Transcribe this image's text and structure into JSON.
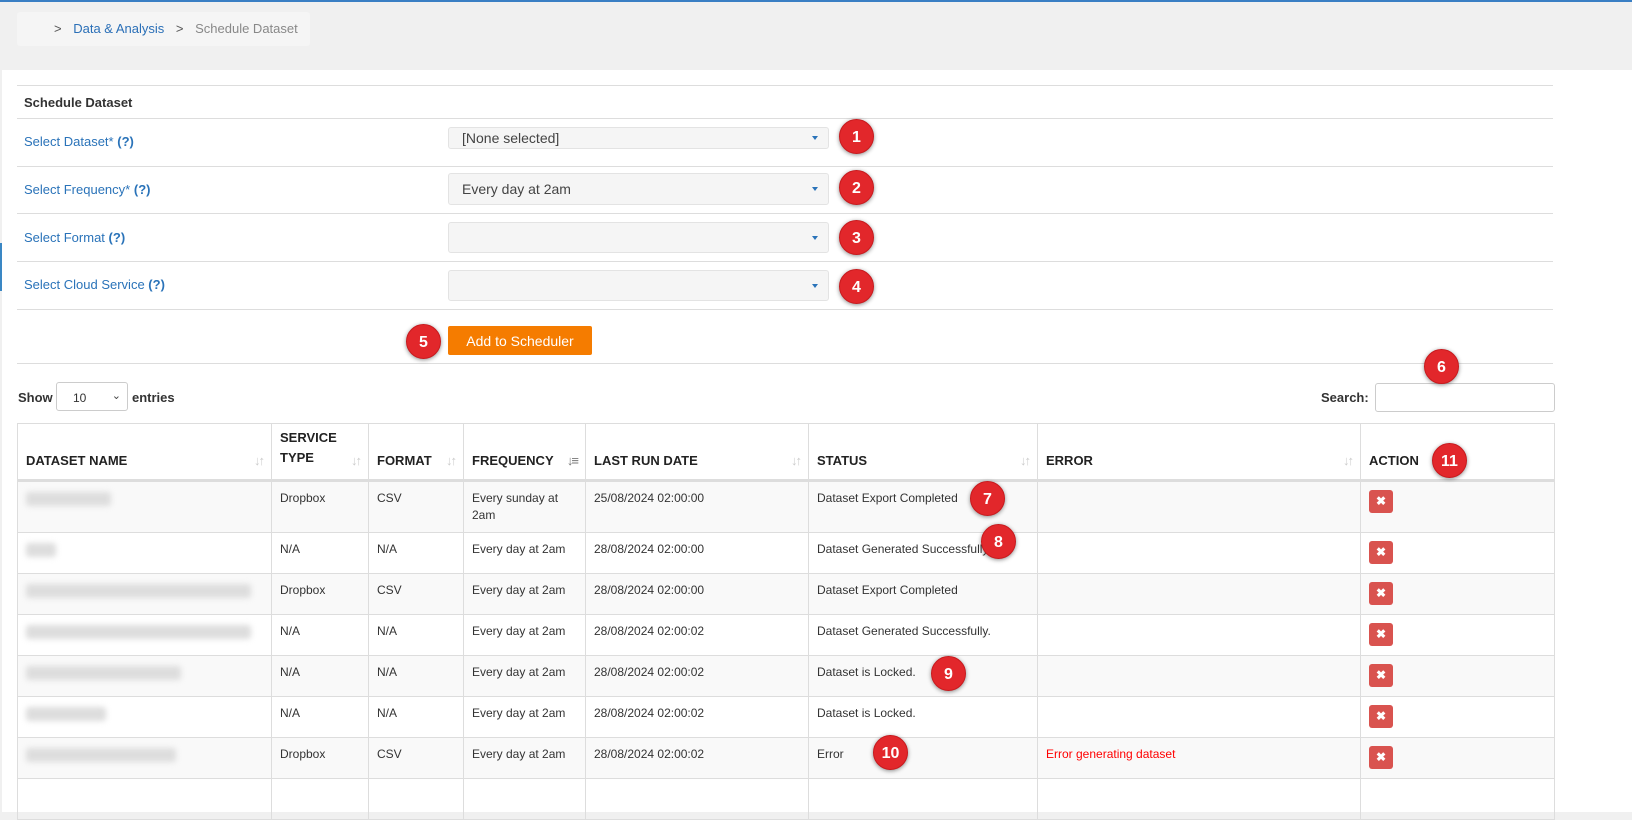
{
  "breadcrumb": {
    "sep": ">",
    "items": [
      {
        "label": "Data & Analysis"
      },
      {
        "label": "Schedule Dataset"
      }
    ]
  },
  "form": {
    "title": "Schedule Dataset",
    "fields": [
      {
        "label": "Select Dataset*",
        "help": "(?)",
        "value": "[None selected]"
      },
      {
        "label": "Select Frequency*",
        "help": "(?)",
        "value": "Every day at 2am"
      },
      {
        "label": "Select Format",
        "help": "(?)",
        "value": ""
      },
      {
        "label": "Select Cloud Service",
        "help": "(?)",
        "value": ""
      }
    ],
    "submit_label": "Add to Scheduler"
  },
  "table_controls": {
    "show_label": "Show",
    "page_length": "10",
    "entries_label": "entries",
    "search_label": "Search:",
    "search_value": ""
  },
  "table": {
    "columns": [
      "DATASET NAME",
      "SERVICE TYPE",
      "FORMAT",
      "FREQUENCY",
      "LAST RUN DATE",
      "STATUS",
      "ERROR",
      "ACTION"
    ],
    "sorted_column": "FREQUENCY",
    "rows": [
      {
        "service": "Dropbox",
        "format": "CSV",
        "frequency": "Every sunday at 2am",
        "last_run": "25/08/2024 02:00:00",
        "status": "Dataset Export Completed",
        "error": ""
      },
      {
        "service": "N/A",
        "format": "N/A",
        "frequency": "Every day at 2am",
        "last_run": "28/08/2024 02:00:00",
        "status": "Dataset Generated Successfully.",
        "error": ""
      },
      {
        "service": "Dropbox",
        "format": "CSV",
        "frequency": "Every day at 2am",
        "last_run": "28/08/2024 02:00:00",
        "status": "Dataset Export Completed",
        "error": ""
      },
      {
        "service": "N/A",
        "format": "N/A",
        "frequency": "Every day at 2am",
        "last_run": "28/08/2024 02:00:02",
        "status": "Dataset Generated Successfully.",
        "error": ""
      },
      {
        "service": "N/A",
        "format": "N/A",
        "frequency": "Every day at 2am",
        "last_run": "28/08/2024 02:00:02",
        "status": "Dataset is Locked.",
        "error": ""
      },
      {
        "service": "N/A",
        "format": "N/A",
        "frequency": "Every day at 2am",
        "last_run": "28/08/2024 02:00:02",
        "status": "Dataset is Locked.",
        "error": ""
      },
      {
        "service": "Dropbox",
        "format": "CSV",
        "frequency": "Every day at 2am",
        "last_run": "28/08/2024 02:00:02",
        "status": "Error",
        "error": "Error generating dataset"
      }
    ],
    "delete_icon": "x-icon"
  },
  "annotations": [
    "1",
    "2",
    "3",
    "4",
    "5",
    "6",
    "7",
    "8",
    "9",
    "10",
    "11"
  ],
  "colors": {
    "accent": "#2a73b9",
    "button": "#f57c00",
    "badge": "#e2272b",
    "delete": "#d9534f",
    "error": "#ff0000"
  }
}
